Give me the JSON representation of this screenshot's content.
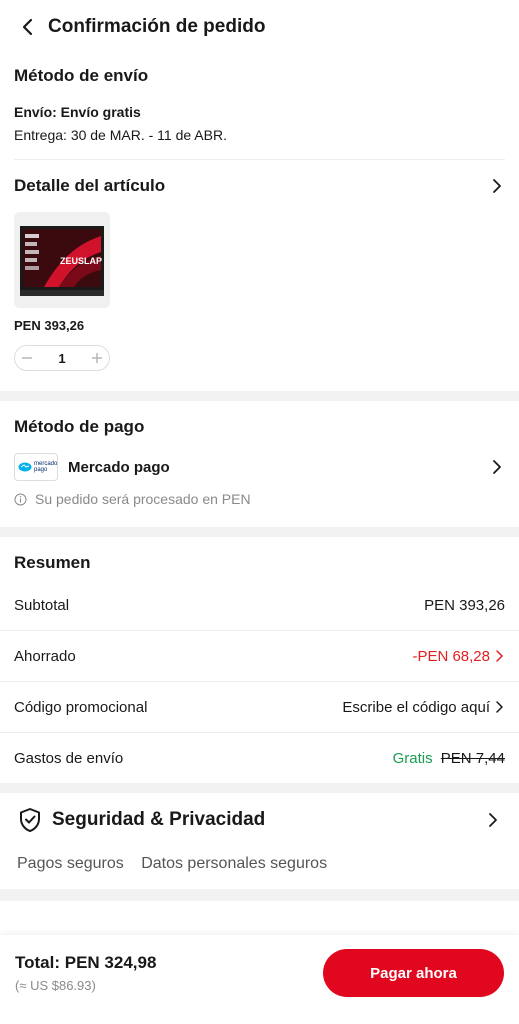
{
  "header": {
    "title": "Confirmación de pedido"
  },
  "shipping": {
    "title": "Método de envío",
    "method": "Envío: Envío gratis",
    "delivery": "Entrega: 30 de MAR. - 11 de ABR."
  },
  "item": {
    "title": "Detalle del artículo",
    "price": "PEN 393,26",
    "quantity": "1",
    "image_badge": "ZEUSLAP"
  },
  "payment": {
    "title": "Método de pago",
    "logo_text": "mercado pago",
    "method": "Mercado pago",
    "note": "Su pedido será procesado en PEN"
  },
  "summary": {
    "title": "Resumen",
    "subtotal_label": "Subtotal",
    "subtotal_value": "PEN 393,26",
    "saved_label": "Ahorrado",
    "saved_value": "-PEN 68,28",
    "promo_label": "Código promocional",
    "promo_value": "Escribe el código aquí",
    "shipping_label": "Gastos de envío",
    "shipping_free": "Gratis",
    "shipping_original": "PEN 7,44"
  },
  "security": {
    "title": "Seguridad & Privacidad",
    "item1": "Pagos seguros",
    "item2": "Datos personales seguros"
  },
  "footer": {
    "total": "Total: PEN 324,98",
    "usd": "(≈ US $86.93)",
    "pay_button": "Pagar ahora"
  },
  "colors": {
    "accent": "#e0071f",
    "green": "#1a9c52",
    "red_text": "#e02020"
  }
}
